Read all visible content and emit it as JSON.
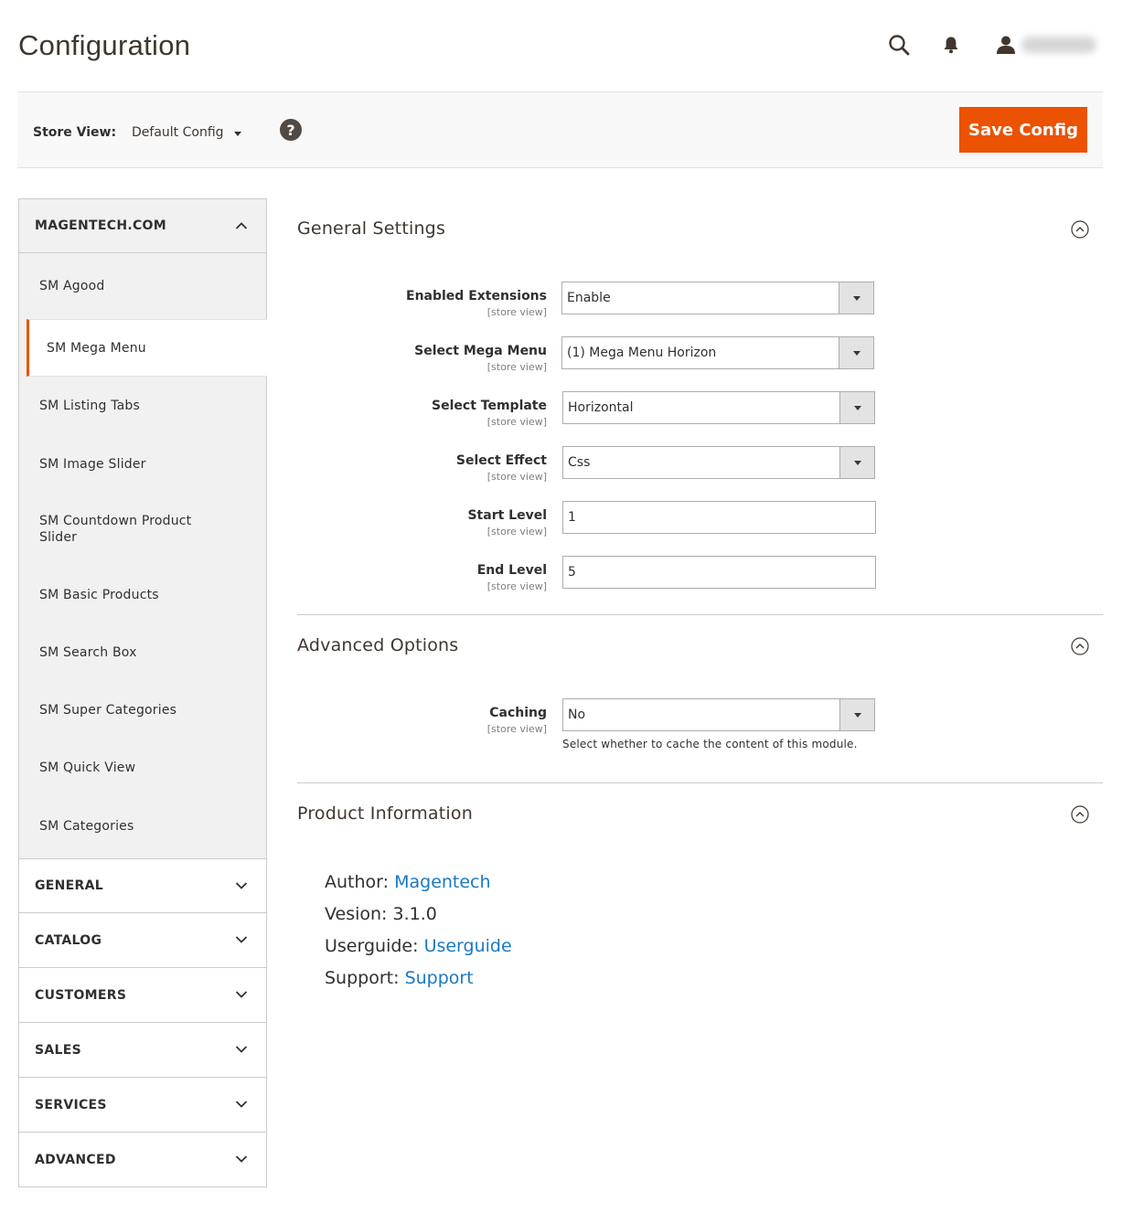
{
  "page": {
    "title": "Configuration"
  },
  "header": {
    "icons": [
      "search-icon",
      "bell-icon",
      "user-icon"
    ]
  },
  "toolbar": {
    "store_label": "Store View:",
    "store_value": "Default Config",
    "help_glyph": "?",
    "save_label": "Save Config"
  },
  "sidebar": {
    "magentech": {
      "label": "MAGENTECH.COM",
      "items": [
        {
          "label": "SM Agood"
        },
        {
          "label": "SM Mega Menu"
        },
        {
          "label": "SM Listing Tabs"
        },
        {
          "label": "SM Image Slider"
        },
        {
          "label": "SM Countdown Product Slider"
        },
        {
          "label": "SM Basic Products"
        },
        {
          "label": "SM Search Box"
        },
        {
          "label": "SM Super Categories"
        },
        {
          "label": "SM Quick View"
        },
        {
          "label": "SM Categories"
        }
      ]
    },
    "groups": [
      {
        "label": "GENERAL"
      },
      {
        "label": "CATALOG"
      },
      {
        "label": "CUSTOMERS"
      },
      {
        "label": "SALES"
      },
      {
        "label": "SERVICES"
      },
      {
        "label": "ADVANCED"
      }
    ]
  },
  "general": {
    "title": "General Settings",
    "fields": [
      {
        "label": "Enabled Extensions",
        "scope": "[store view]",
        "value": "Enable"
      },
      {
        "label": "Select Mega Menu",
        "scope": "[store view]",
        "value": "(1) Mega Menu Horizon"
      },
      {
        "label": "Select Template",
        "scope": "[store view]",
        "value": "Horizontal"
      },
      {
        "label": "Select Effect",
        "scope": "[store view]",
        "value": "Css"
      },
      {
        "label": "Start Level",
        "scope": "[store view]",
        "value": "1"
      },
      {
        "label": "End Level",
        "scope": "[store view]",
        "value": "5"
      }
    ]
  },
  "advanced": {
    "title": "Advanced Options",
    "caching": {
      "label": "Caching",
      "scope": "[store view]",
      "value": "No",
      "note": "Select whether to cache the content of this module."
    }
  },
  "product_info": {
    "title": "Product Information",
    "author_label": "Author:",
    "author_link": "Magentech",
    "version_text": "Vesion: 3.1.0",
    "userguide_label": "Userguide:",
    "userguide_link": "Userguide",
    "support_label": "Support:",
    "support_link": "Support"
  },
  "colors": {
    "accent": "#eb5202",
    "link": "#1979c3",
    "sidebar_bg": "#f1f1f1",
    "toolbar_bg": "#f8f8f8"
  }
}
